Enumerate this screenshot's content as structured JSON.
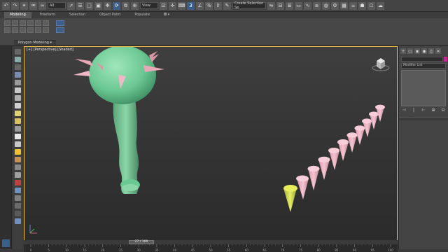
{
  "app": {
    "name": "3ds Max"
  },
  "toolbar": {
    "selection_filter": "All",
    "view_dropdown": "View",
    "named_selection_placeholder": "Create Selection Se",
    "undo_icon": "undo-icon",
    "redo_icon": "redo-icon"
  },
  "ribbon": {
    "tabs": [
      {
        "label": "Modeling",
        "active": true
      },
      {
        "label": "Freeform",
        "active": false
      },
      {
        "label": "Selection",
        "active": false
      },
      {
        "label": "Object Paint",
        "active": false
      },
      {
        "label": "Populate",
        "active": false
      }
    ],
    "panel_label": "Polygon Modeling"
  },
  "viewport": {
    "label": "[+] [Perspective] [Shaded]",
    "border_color": "#f0c040",
    "objects": [
      {
        "name": "mace",
        "color": "#7fd4a0"
      },
      {
        "name": "spike-cones",
        "count": 12,
        "color": "#f2b8c6",
        "selected_color": "#d6e04a"
      }
    ]
  },
  "command_panel": {
    "tabs": [
      "+",
      "▭",
      "▪",
      "◉",
      "▯",
      "✕"
    ],
    "object_color": "#c02a8c",
    "modifier_list": "Modifier List",
    "stack_tools": [
      "⊣",
      "|",
      "⊢",
      "⊞",
      "⊟"
    ]
  },
  "timeline": {
    "frame_display": "27 / 100",
    "ticks": [
      "0",
      "5",
      "10",
      "15",
      "20",
      "25",
      "30",
      "35",
      "40",
      "45",
      "50",
      "55",
      "60",
      "65",
      "70",
      "75",
      "80",
      "85",
      "90",
      "95",
      "100"
    ]
  }
}
